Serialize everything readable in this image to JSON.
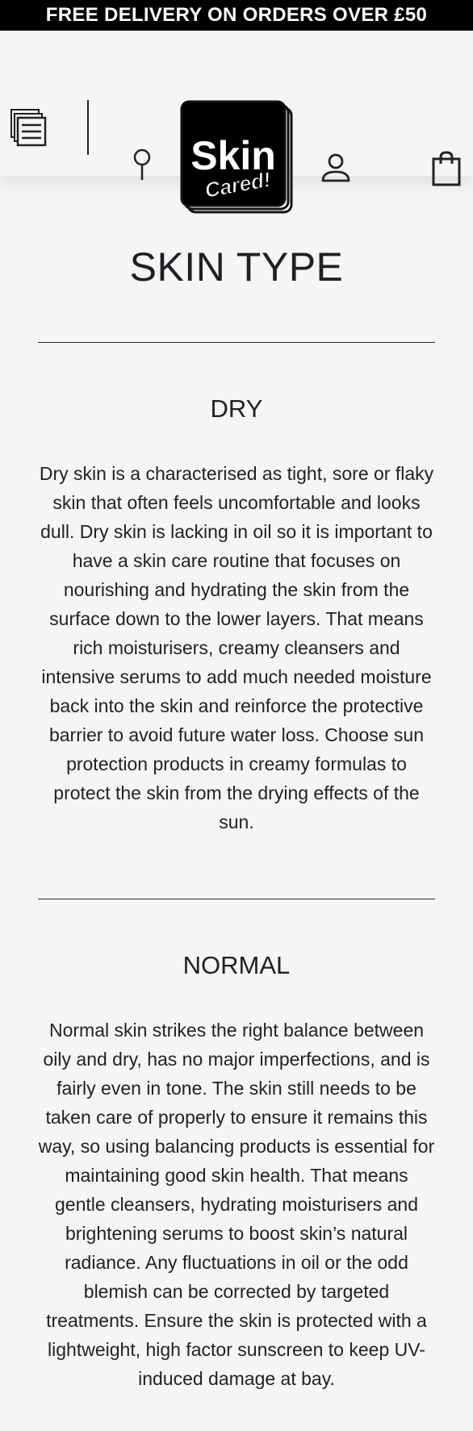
{
  "promo": {
    "text": "FREE DELIVERY ON ORDERS OVER £50"
  },
  "header": {
    "logo": {
      "line1": "Skin",
      "line2": "Cared!"
    },
    "icons": {
      "menu": "menu-icon",
      "store": "store-locator-icon",
      "account": "account-icon",
      "bag": "shopping-bag-icon"
    }
  },
  "page": {
    "title": "SKIN TYPE"
  },
  "sections": [
    {
      "title": "DRY",
      "text": "Dry skin is a characterised as tight, sore or flaky skin that often feels uncomfortable and looks dull. Dry skin is lacking in oil so it is important to have a skin care routine that focuses on nourishing and hydrating the skin from the surface down to the lower layers. That means rich moisturisers, creamy cleansers and intensive serums to add much needed moisture back into the skin and reinforce the protective barrier to avoid future water loss. Choose sun protection products in creamy formulas to protect the skin from the drying effects of the sun."
    },
    {
      "title": "NORMAL",
      "text": "Normal skin strikes the right balance between oily and dry, has no major imperfections, and is fairly even in tone. The skin still needs to be taken care of properly to ensure it remains this way, so using balancing products is essential for maintaining good skin health. That means gentle cleansers, hydrating moisturisers and brightening serums to boost skin’s natural radiance. Any fluctuations in oil or the odd blemish can be corrected by targeted treatments. Ensure the skin is protected with a lightweight, high factor sunscreen to keep UV-induced damage at bay."
    }
  ]
}
